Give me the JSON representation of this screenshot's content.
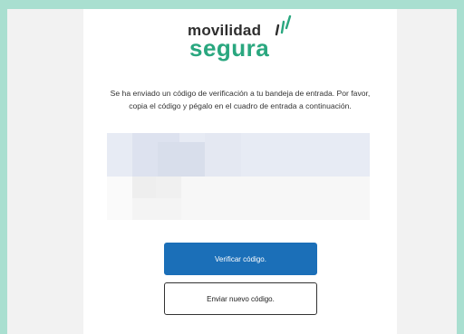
{
  "logo": {
    "top_word": "movilidad",
    "bottom_word": "segura",
    "icon": "accent-marks-icon",
    "colors": {
      "dark": "#2e2e2e",
      "green": "#2aa77f"
    }
  },
  "message": "Se ha enviado un código de verificación a tu bandeja de entrada. Por favor, copia el código y pégalo en el cuadro de entrada a continuación.",
  "buttons": {
    "verify": "Verificar código.",
    "resend": "Enviar nuevo código."
  },
  "colors": {
    "background": "#a9dfd0",
    "primary": "#1b6fb8"
  }
}
